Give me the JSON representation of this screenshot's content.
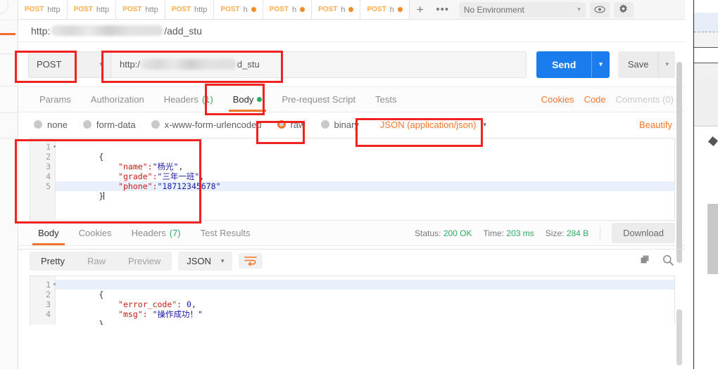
{
  "app": {
    "name": "Postman"
  },
  "tabbar": {
    "tabs": [
      {
        "method": "POST",
        "name": "http",
        "unsaved": false
      },
      {
        "method": "POST",
        "name": "http",
        "unsaved": false
      },
      {
        "method": "POST",
        "name": "http",
        "unsaved": false
      },
      {
        "method": "POST",
        "name": "http",
        "unsaved": false
      },
      {
        "method": "POST",
        "name": "h",
        "unsaved": true
      },
      {
        "method": "POST",
        "name": "h",
        "unsaved": true
      },
      {
        "method": "POST",
        "name": "h",
        "unsaved": true
      },
      {
        "method": "POST",
        "name": "h",
        "unsaved": true
      }
    ],
    "new_tab_label": "+",
    "more_label": "•••",
    "environment": {
      "selected": "No Environment",
      "caret": "▾"
    },
    "eye_icon": "eye-icon",
    "gear_icon": "gear-icon"
  },
  "breadcrumb": {
    "prefix": "http:",
    "redacted": true,
    "suffix": "/add_stu"
  },
  "request": {
    "method": "POST",
    "method_caret": "▾",
    "url_prefix": "http:/",
    "url_suffix": "d_stu",
    "send_label": "Send",
    "send_caret": "▾",
    "save_label": "Save",
    "save_caret": "▾",
    "tabs": [
      {
        "label": "Params",
        "active": false
      },
      {
        "label": "Authorization",
        "active": false
      },
      {
        "label": "Headers",
        "count": "(1)",
        "active": false
      },
      {
        "label": "Body",
        "active": true,
        "green_dot": true
      },
      {
        "label": "Pre-request Script",
        "active": false
      },
      {
        "label": "Tests",
        "active": false
      }
    ],
    "tabs_right": [
      {
        "label": "Cookies",
        "muted": false
      },
      {
        "label": "Code",
        "muted": false
      },
      {
        "label": "Comments (0)",
        "muted": true
      }
    ],
    "body_types": [
      {
        "label": "none",
        "selected": false
      },
      {
        "label": "form-data",
        "selected": false
      },
      {
        "label": "x-www-form-urlencoded",
        "selected": false
      },
      {
        "label": "raw",
        "selected": true
      },
      {
        "label": "binary",
        "selected": false
      }
    ],
    "content_type": "JSON (application/json)",
    "content_type_caret": "▾",
    "beautify_label": "Beautify",
    "editor": {
      "line_numbers": [
        "1",
        "2",
        "3",
        "4",
        "5"
      ],
      "fold_marker": "▾",
      "current_line": 5,
      "lines": [
        [
          {
            "t": "{",
            "c": "p"
          }
        ],
        [
          {
            "t": "    \"name\":",
            "c": "k"
          },
          {
            "t": "\"杨光\"",
            "c": "v"
          },
          {
            "t": ",",
            "c": "p"
          }
        ],
        [
          {
            "t": "    \"grade\":",
            "c": "k"
          },
          {
            "t": "\"三年一班\"",
            "c": "v"
          },
          {
            "t": ",",
            "c": "p"
          }
        ],
        [
          {
            "t": "    \"phone\":",
            "c": "k"
          },
          {
            "t": "\"18712345678\"",
            "c": "v"
          }
        ],
        [
          {
            "t": "}",
            "c": "p"
          }
        ]
      ]
    }
  },
  "response": {
    "tabs": [
      {
        "label": "Body",
        "active": true
      },
      {
        "label": "Cookies",
        "active": false
      },
      {
        "label": "Headers",
        "count": "(7)",
        "active": false
      },
      {
        "label": "Test Results",
        "active": false
      }
    ],
    "meta": {
      "status_label": "Status:",
      "status_value": "200 OK",
      "time_label": "Time:",
      "time_value": "203 ms",
      "size_label": "Size:",
      "size_value": "284 B"
    },
    "download_label": "Download",
    "view_modes": [
      {
        "label": "Pretty",
        "active": true
      },
      {
        "label": "Raw",
        "active": false
      },
      {
        "label": "Preview",
        "active": false
      }
    ],
    "format": "JSON",
    "format_caret": "▾",
    "wrap_icon": "word-wrap-icon",
    "copy_icon": "copy-icon",
    "search_icon": "search-icon",
    "editor": {
      "line_numbers": [
        "1",
        "2",
        "3",
        "4"
      ],
      "fold_marker": "▾",
      "current_line": 1,
      "lines": [
        [
          {
            "t": "{",
            "c": "p"
          }
        ],
        [
          {
            "t": "    \"error_code\":",
            "c": "k"
          },
          {
            "t": " 0",
            "c": "v"
          },
          {
            "t": ",",
            "c": "p"
          }
        ],
        [
          {
            "t": "    \"msg\":",
            "c": "k"
          },
          {
            "t": " \"操作成功！\"",
            "c": "v"
          }
        ],
        [
          {
            "t": "}",
            "c": "p"
          }
        ]
      ]
    }
  },
  "annotations": {
    "color": "#ef2121",
    "boxes": [
      "method-selector",
      "url-input",
      "body-tab",
      "raw-radio",
      "json-content-type",
      "request-body-editor"
    ]
  }
}
